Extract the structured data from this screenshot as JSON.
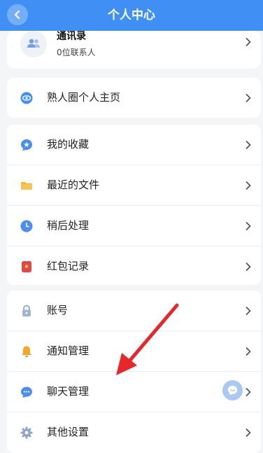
{
  "header": {
    "title": "个人中心"
  },
  "contacts": {
    "name": "通讯录",
    "count_text": "0位联系人"
  },
  "moments": {
    "label": "熟人圈个人主页"
  },
  "group_tools": [
    {
      "label": "我的收藏",
      "icon": "star-bubble-icon"
    },
    {
      "label": "最近的文件",
      "icon": "folder-icon"
    },
    {
      "label": "稍后处理",
      "icon": "clock-icon"
    },
    {
      "label": "红包记录",
      "icon": "red-envelope-icon"
    }
  ],
  "group_settings": [
    {
      "label": "账号",
      "icon": "lock-icon"
    },
    {
      "label": "通知管理",
      "icon": "bell-icon"
    },
    {
      "label": "聊天管理",
      "icon": "chat-bubble-icon"
    },
    {
      "label": "其他设置",
      "icon": "gear-icon"
    }
  ],
  "colors": {
    "header": "#3f8ff5",
    "annotation_arrow": "#e8272a"
  }
}
